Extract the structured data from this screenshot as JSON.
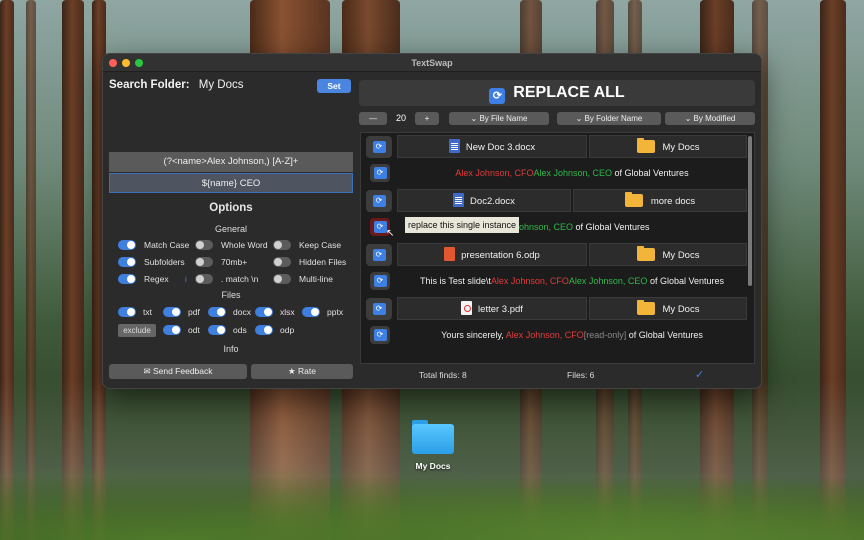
{
  "app": {
    "title": "TextSwap"
  },
  "search": {
    "label": "Search Folder:",
    "folder": "My Docs",
    "set_label": "Set"
  },
  "find_pattern": "(?<name>Alex Johnson,) [A-Z]+",
  "replace_pattern": "${name} CEO",
  "options": {
    "heading": "Options",
    "general_heading": "General",
    "general": [
      {
        "label": "Match Case",
        "on": true
      },
      {
        "label": "Whole Word",
        "on": false
      },
      {
        "label": "Keep Case",
        "on": false
      },
      {
        "label": "Subfolders",
        "on": true
      },
      {
        "label": "70mb+",
        "on": false
      },
      {
        "label": "Hidden Files",
        "on": false
      },
      {
        "label": "Regex",
        "on": true
      },
      {
        "label": ". match \\n",
        "on": false
      },
      {
        "label": "Multi-line",
        "on": false
      }
    ],
    "info_icon": "i",
    "files_heading": "Files",
    "files": [
      {
        "label": "txt",
        "on": true
      },
      {
        "label": "pdf",
        "on": true
      },
      {
        "label": "docx",
        "on": true
      },
      {
        "label": "xlsx",
        "on": true
      },
      {
        "label": "pptx",
        "on": true
      },
      {
        "label": "odt",
        "on": true
      },
      {
        "label": "ods",
        "on": true
      },
      {
        "label": "odp",
        "on": true
      }
    ],
    "exclude_label": "exclude",
    "info_heading": "Info",
    "feedback_label": "✉ Send Feedback",
    "rate_label": "★ Rate"
  },
  "replace_all_label": "REPLACE ALL",
  "controls": {
    "minus": "—",
    "count": "20",
    "plus": "+",
    "sort_name": "⌄ By File Name",
    "sort_folder": "⌄ By Folder Name",
    "sort_modified": "⌄ By Modified"
  },
  "results": [
    {
      "file": "New Doc 3.docx",
      "icon": "docx",
      "folder": "My Docs",
      "segments": [
        {
          "t": "Alex Johnson, CFO",
          "c": "red"
        },
        {
          "t": "Alex Johnson, CEO",
          "c": "green"
        },
        {
          "t": " of Global Ventures",
          "c": "white"
        }
      ]
    },
    {
      "file": "Doc2.docx",
      "icon": "docx",
      "folder": "more docs",
      "segments": [
        {
          "t": "Alex Johnson, CEO",
          "c": "green"
        },
        {
          "t": " of Global Ventures",
          "c": "white"
        }
      ]
    },
    {
      "file": "presentation 6.odp",
      "icon": "ppt",
      "folder": "My Docs",
      "segments": [
        {
          "t": "This is Test slide\\t",
          "c": "white"
        },
        {
          "t": "Alex Johnson, CFO",
          "c": "red"
        },
        {
          "t": "Alex Johnson, CEO",
          "c": "green"
        },
        {
          "t": " of Global Ventures",
          "c": "white"
        }
      ]
    },
    {
      "file": "letter 3.pdf",
      "icon": "pdf",
      "folder": "My Docs",
      "segments": [
        {
          "t": "Yours sincerely, ",
          "c": "white"
        },
        {
          "t": "Alex Johnson, CFO",
          "c": "red"
        },
        {
          "t": "[read-only]",
          "c": "gray"
        },
        {
          "t": " of Global Ventures",
          "c": "white"
        }
      ]
    }
  ],
  "tooltip": "replace this single instance",
  "status": {
    "total_finds": "Total finds: 8",
    "files": "Files: 6",
    "check": "✓"
  },
  "desktop": {
    "folder_label": "My Docs"
  },
  "colors": {
    "accent": "#3f7fe0",
    "find": "#e23b3b",
    "replace": "#2fb94a"
  }
}
